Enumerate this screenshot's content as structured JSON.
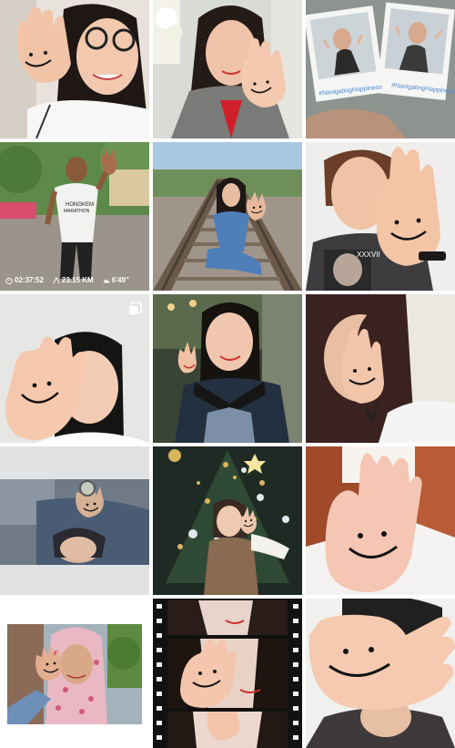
{
  "grid": {
    "tiles": [
      {
        "id": 1,
        "subject": "woman with glasses, smiley palm"
      },
      {
        "id": 2,
        "subject": "woman in blazer, smiley palm"
      },
      {
        "id": 3,
        "subject": "polaroid photos held in hand"
      },
      {
        "id": 4,
        "subject": "runner with smiley palm"
      },
      {
        "id": 5,
        "subject": "girl sitting on railway tracks"
      },
      {
        "id": 6,
        "subject": "boy in t-shirt, smiley palm"
      },
      {
        "id": 7,
        "subject": "girl covering face with smiley palm"
      },
      {
        "id": 8,
        "subject": "woman in black off-shoulder top"
      },
      {
        "id": 9,
        "subject": "woman with palm over eye"
      },
      {
        "id": 10,
        "subject": "person lying down, smiley palm"
      },
      {
        "id": 11,
        "subject": "woman by christmas tree"
      },
      {
        "id": 12,
        "subject": "smiley palm close-up, red hair"
      },
      {
        "id": 13,
        "subject": "woman in floral hijab"
      },
      {
        "id": 14,
        "subject": "film strip of three frames"
      },
      {
        "id": 15,
        "subject": "large smiley palm over face"
      }
    ]
  },
  "runner_stats": {
    "time": "02:37:52",
    "distance": "23.15 KM",
    "pace": "6'49\""
  },
  "polaroid": {
    "caption_left": "#NavigatingHappiness",
    "caption_right": "#NavigatingHappiness"
  },
  "shirt_text": {
    "line1": "HONGKEM",
    "line2": "MARATHON"
  },
  "icons": {
    "stopwatch": "stopwatch-icon",
    "distance": "distance-icon",
    "pace": "shoe-icon",
    "multi": "multiple-photos-icon"
  }
}
